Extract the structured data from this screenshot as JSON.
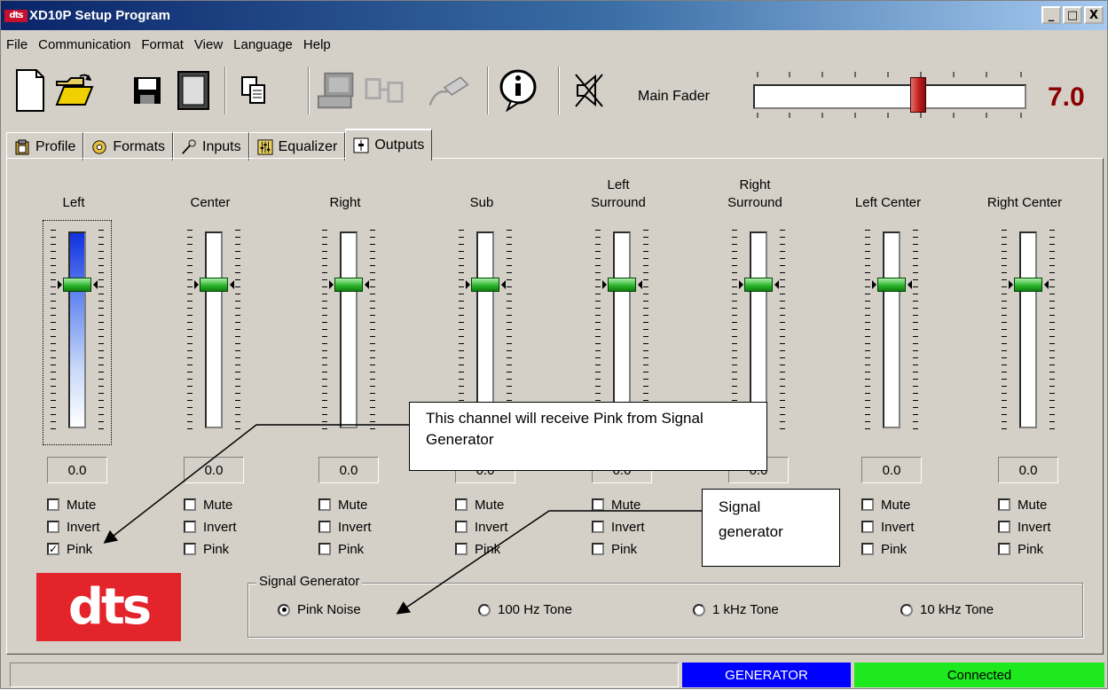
{
  "window": {
    "app_icon_text": "dts",
    "title": "XD10P Setup Program",
    "buttons": [
      "_",
      "□",
      "X"
    ]
  },
  "menu": [
    "File",
    "Communication",
    "Format",
    "View",
    "Language",
    "Help"
  ],
  "toolbar": {
    "buttons": [
      "new-file-icon",
      "open-folder-icon",
      "save-disk-icon",
      "preset-icon",
      "copy-icon",
      "computer-icon",
      "transfer-icon",
      "cable-icon",
      "info-icon",
      "mute-speaker-icon"
    ],
    "main_fader": {
      "label": "Main Fader",
      "value": "7.0",
      "level": 0.6
    }
  },
  "tabs": [
    "Profile",
    "Formats",
    "Inputs",
    "Equalizer",
    "Outputs"
  ],
  "active_tab": "Outputs",
  "channels": [
    {
      "name": "Left",
      "value": "0.0",
      "mute": false,
      "invert": false,
      "pink": true
    },
    {
      "name": "Center",
      "value": "0.0",
      "mute": false,
      "invert": false,
      "pink": false
    },
    {
      "name": "Right",
      "value": "0.0",
      "mute": false,
      "invert": false,
      "pink": false
    },
    {
      "name": "Sub",
      "value": "0.0",
      "mute": false,
      "invert": false,
      "pink": false
    },
    {
      "name": "Left\nSurround",
      "value": "0.0",
      "mute": false,
      "invert": false,
      "pink": false
    },
    {
      "name": "Right\nSurround",
      "value": "0.0",
      "mute": false,
      "invert": false,
      "pink": false
    },
    {
      "name": "Left Center",
      "value": "0.0",
      "mute": false,
      "invert": false,
      "pink": false
    },
    {
      "name": "Right Center",
      "value": "0.0",
      "mute": false,
      "invert": false,
      "pink": false
    }
  ],
  "checkbox_labels": {
    "mute": "Mute",
    "invert": "Invert",
    "pink": "Pink"
  },
  "logo_text": "dts",
  "signal_generator": {
    "legend": "Signal Generator",
    "options": [
      "Pink Noise",
      "100 Hz Tone",
      "1 kHz Tone",
      "10 kHz Tone"
    ],
    "selected": "Pink Noise"
  },
  "status": {
    "left": "",
    "mode": "GENERATOR",
    "connection": "Connected",
    "mode_color": "#0000ff",
    "connection_color": "#1ee81e"
  },
  "callouts": {
    "pink_channel": "This channel will receive Pink from Signal Generator",
    "signal_generator": "Signal generator"
  }
}
